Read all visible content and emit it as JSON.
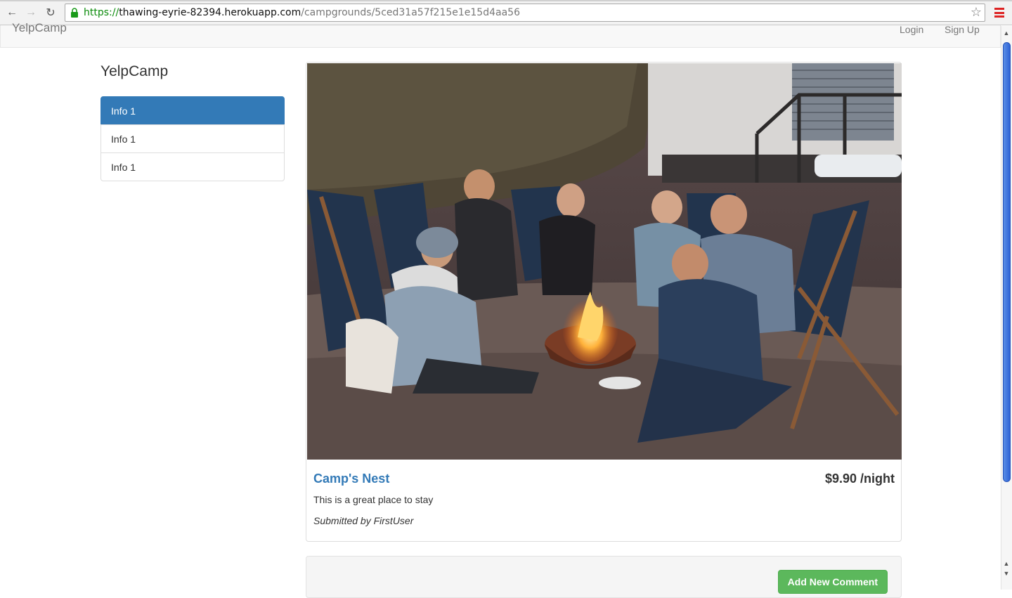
{
  "browser": {
    "url_scheme": "https://",
    "url_host": "thawing-eyrie-82394.herokuapp.com",
    "url_path": "/campgrounds/5ced31a57f215e1e15d4aa56"
  },
  "navbar": {
    "brand": "YelpCamp",
    "login": "Login",
    "signup": "Sign Up"
  },
  "sidebar": {
    "title": "YelpCamp",
    "items": [
      {
        "label": "Info 1",
        "active": true
      },
      {
        "label": "Info 1",
        "active": false
      },
      {
        "label": "Info 1",
        "active": false
      }
    ]
  },
  "campground": {
    "name": "Camp's Nest",
    "price": "$9.90 /night",
    "description": "This is a great place to stay",
    "author_line": "Submitted by FirstUser"
  },
  "comments": {
    "add_button": "Add New Comment"
  },
  "colors": {
    "primary": "#337ab7",
    "success": "#5cb85c"
  }
}
